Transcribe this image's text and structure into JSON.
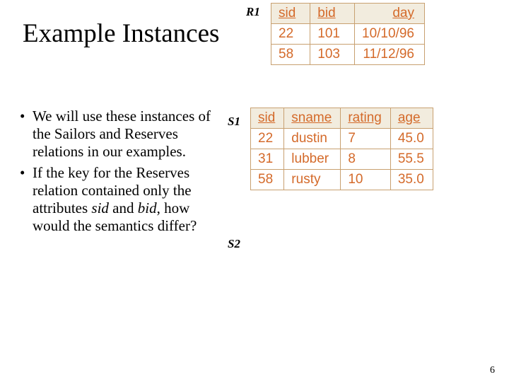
{
  "title": "Example Instances",
  "labels": {
    "r1": "R1",
    "s1": "S1",
    "s2": "S2"
  },
  "bullets": {
    "item1": "We will use these instances of the Sailors and Reserves relations in our examples.",
    "item2_pre": "If the key for the Reserves relation contained only the attributes ",
    "item2_sid": "sid",
    "item2_and": " and ",
    "item2_bid": "bid",
    "item2_post": ", how would the semantics differ?"
  },
  "r1": {
    "h0": "sid",
    "h1": "bid",
    "h2": "day",
    "r0c0": "22",
    "r0c1": "101",
    "r0c2": "10/10/96",
    "r1c0": "58",
    "r1c1": "103",
    "r1c2": "11/12/96"
  },
  "s1": {
    "h0": "sid",
    "h1": "sname",
    "h2": "rating",
    "h3": "age",
    "r0c0": "22",
    "r0c1": "dustin",
    "r0c2": "7",
    "r0c3": "45.0",
    "r1c0": "31",
    "r1c1": "lubber",
    "r1c2": "8",
    "r1c3": "55.5",
    "r2c0": "58",
    "r2c1": "rusty",
    "r2c2": "10",
    "r2c3": "35.0"
  },
  "page_num": "6",
  "chart_data": [
    {
      "type": "table",
      "title": "R1",
      "columns": [
        "sid",
        "bid",
        "day"
      ],
      "rows": [
        [
          22,
          101,
          "10/10/96"
        ],
        [
          58,
          103,
          "11/12/96"
        ]
      ]
    },
    {
      "type": "table",
      "title": "S1",
      "columns": [
        "sid",
        "sname",
        "rating",
        "age"
      ],
      "rows": [
        [
          22,
          "dustin",
          7,
          45.0
        ],
        [
          31,
          "lubber",
          8,
          55.5
        ],
        [
          58,
          "rusty",
          10,
          35.0
        ]
      ]
    }
  ]
}
